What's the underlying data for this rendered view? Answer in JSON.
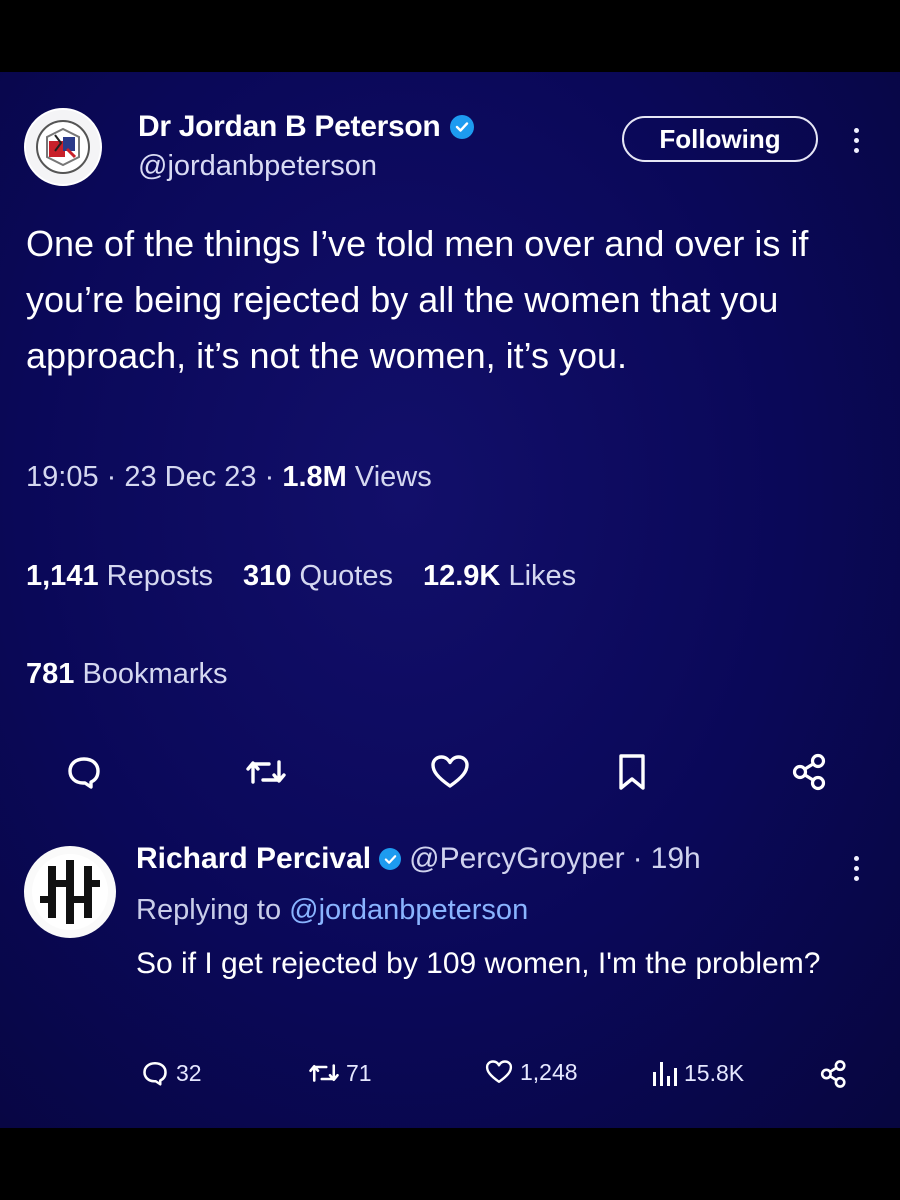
{
  "main_tweet": {
    "author_name": "Dr Jordan B Peterson",
    "author_handle": "@jordanbpeterson",
    "follow_label": "Following",
    "text": "One of the things I’ve told men over and over is if you’re being rejected by all the women that you approach, it’s not the women, it’s you.",
    "time": "19:05",
    "separator": " · ",
    "date": "23 Dec 23",
    "views_count": "1.8M",
    "views_label": "Views",
    "reposts_count": "1,141",
    "reposts_label": "Reposts",
    "quotes_count": "310",
    "quotes_label": "Quotes",
    "likes_count": "12.9K",
    "likes_label": "Likes",
    "bookmarks_count": "781",
    "bookmarks_label": "Bookmarks",
    "actions": [
      "reply-icon",
      "repost-icon",
      "like-icon",
      "bookmark-icon",
      "share-icon"
    ]
  },
  "reply": {
    "author_name": "Richard Percival",
    "author_handle": "@PercyGroyper",
    "separator": "·",
    "age": "19h",
    "replying_prefix": "Replying to",
    "replying_to": "@jordanbpeterson",
    "text": "So if I get rejected by 109 women, I'm the problem?",
    "reply_count": "32",
    "repost_count": "71",
    "like_count": "1,248",
    "view_count": "15.8K"
  },
  "colors": {
    "background": "#0a0858",
    "verified": "#1d9bf0",
    "mention": "#8ab4ff"
  }
}
